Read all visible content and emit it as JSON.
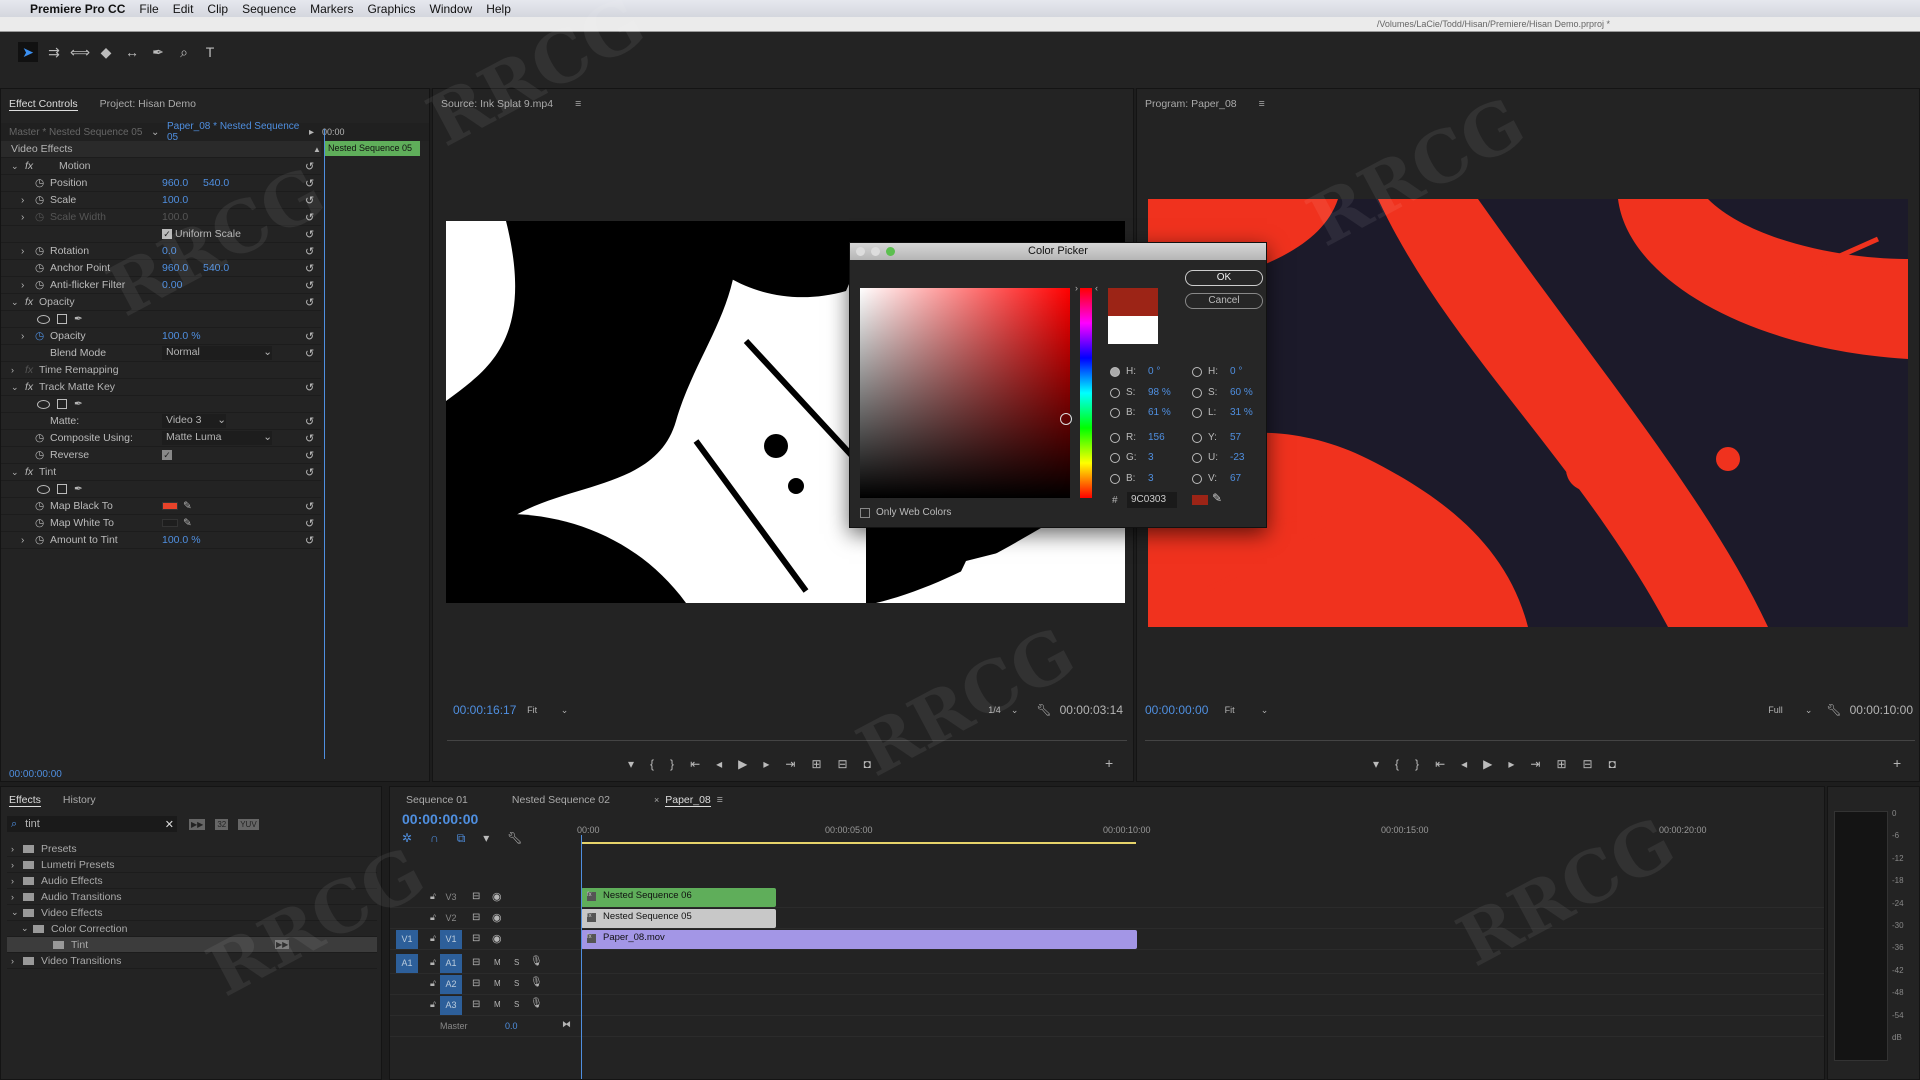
{
  "menu": {
    "app": "Premiere Pro CC",
    "items": [
      "File",
      "Edit",
      "Clip",
      "Sequence",
      "Markers",
      "Graphics",
      "Window",
      "Help"
    ]
  },
  "title_path": "/Volumes/LaCie/Todd/Hisan/Premiere/Hisan Demo.prproj *",
  "tools": [
    "selection-tool",
    "track-select-tool",
    "ripple-edit-tool",
    "razor-tool",
    "slip-tool",
    "pen-tool",
    "zoom-tool",
    "type-tool"
  ],
  "effect_controls": {
    "tabs": [
      "Effect Controls",
      "Project: Hisan Demo"
    ],
    "master": "Master * Nested Sequence 05",
    "clip": "Paper_08 * Nested Sequence 05",
    "ruler_time": "00:00",
    "clip_bar": "Nested Sequence 05",
    "section": "Video Effects",
    "rows": [
      {
        "t": "fx",
        "label": "Motion"
      },
      {
        "t": "p",
        "label": "Position",
        "v1": "960.0",
        "v2": "540.0"
      },
      {
        "t": "p",
        "label": "Scale",
        "v1": "100.0",
        "exp": true
      },
      {
        "t": "p",
        "label": "Scale Width",
        "v1": "100.0",
        "exp": true,
        "dim": true
      },
      {
        "t": "check",
        "label": "Uniform Scale"
      },
      {
        "t": "p",
        "label": "Rotation",
        "v1": "0.0",
        "exp": true
      },
      {
        "t": "p",
        "label": "Anchor Point",
        "v1": "960.0",
        "v2": "540.0"
      },
      {
        "t": "p",
        "label": "Anti-flicker Filter",
        "v1": "0.00",
        "exp": true
      },
      {
        "t": "fx",
        "label": "Opacity"
      },
      {
        "t": "mask"
      },
      {
        "t": "p",
        "label": "Opacity",
        "v1": "100.0 %",
        "exp": true
      },
      {
        "t": "sel",
        "label": "Blend Mode",
        "v1": "Normal"
      },
      {
        "t": "fx",
        "label": "Time Remapping",
        "collapsed": true
      },
      {
        "t": "fx",
        "label": "Track Matte Key"
      },
      {
        "t": "mask"
      },
      {
        "t": "sel",
        "label": "Matte:",
        "v1": "Video 3"
      },
      {
        "t": "sel",
        "label": "Composite Using:",
        "v1": "Matte Luma"
      },
      {
        "t": "check2",
        "label": "Reverse"
      },
      {
        "t": "fx",
        "label": "Tint"
      },
      {
        "t": "mask"
      },
      {
        "t": "color",
        "label": "Map Black To",
        "c": "#e8432a"
      },
      {
        "t": "color",
        "label": "Map White To",
        "c": "#1e1e1e"
      },
      {
        "t": "p",
        "label": "Amount to Tint",
        "v1": "100.0 %",
        "exp": true
      }
    ],
    "time": "00:00:00:00"
  },
  "source": {
    "title": "Source: Ink Splat 9.mp4",
    "timecode": "00:00:16:17",
    "fit": "Fit",
    "resolution": "1/4",
    "duration": "00:00:03:14"
  },
  "program": {
    "title": "Program: Paper_08",
    "timecode": "00:00:00:00",
    "fit": "Fit",
    "resolution": "Full",
    "duration": "00:00:10:00"
  },
  "color_picker": {
    "title": "Color Picker",
    "ok": "OK",
    "cancel": "Cancel",
    "only_web": "Only Web Colors",
    "hex": "9C0303",
    "new_color": "#9c2416",
    "old_color": "#ffffff",
    "left": [
      {
        "k": "H:",
        "v": "0 °",
        "on": true
      },
      {
        "k": "S:",
        "v": "98 %"
      },
      {
        "k": "B:",
        "v": "61 %"
      },
      {
        "k": "R:",
        "v": "156"
      },
      {
        "k": "G:",
        "v": "3"
      },
      {
        "k": "B:",
        "v": "3"
      }
    ],
    "right": [
      {
        "k": "H:",
        "v": "0 °"
      },
      {
        "k": "S:",
        "v": "60 %"
      },
      {
        "k": "L:",
        "v": "31 %"
      },
      {
        "k": "Y:",
        "v": "57"
      },
      {
        "k": "U:",
        "v": "-23"
      },
      {
        "k": "V:",
        "v": "67"
      }
    ]
  },
  "effects": {
    "tabs": [
      "Effects",
      "History"
    ],
    "search": "tint",
    "badges": [
      "32",
      "YUV"
    ],
    "tree": [
      {
        "l": "Presets",
        "d": 0
      },
      {
        "l": "Lumetri Presets",
        "d": 0
      },
      {
        "l": "Audio Effects",
        "d": 0
      },
      {
        "l": "Audio Transitions",
        "d": 0
      },
      {
        "l": "Video Effects",
        "d": 0,
        "open": true
      },
      {
        "l": "Color Correction",
        "d": 1,
        "open": true
      },
      {
        "l": "Tint",
        "d": 2,
        "sel": true
      },
      {
        "l": "Video Transitions",
        "d": 0
      }
    ]
  },
  "timeline": {
    "tabs": [
      "Sequence 01",
      "Nested Sequence 02",
      "Paper_08"
    ],
    "timecode": "00:00:00:00",
    "ruler": [
      "00:00",
      "00:00:05:00",
      "00:00:10:00",
      "00:00:15:00",
      "00:00:20:00"
    ],
    "tracks": [
      {
        "n": "V3"
      },
      {
        "n": "V2"
      },
      {
        "n": "V1",
        "src": "V1"
      },
      {
        "n": "A1",
        "src": "A1",
        "audio": true
      },
      {
        "n": "A2",
        "audio": true
      },
      {
        "n": "A3",
        "audio": true
      }
    ],
    "master": "Master",
    "master_val": "0.0",
    "clips": [
      {
        "name": "Nested Sequence 06",
        "track": 0,
        "start": 0,
        "end": 3.5,
        "color": "#5fae5a"
      },
      {
        "name": "Nested Sequence 05",
        "track": 1,
        "start": 0,
        "end": 3.5,
        "color": "#c8c8c8"
      },
      {
        "name": "Paper_08.mov",
        "track": 2,
        "start": 0,
        "end": 10,
        "color": "#a396e6"
      }
    ]
  },
  "meter": {
    "ticks": [
      "0",
      "-6",
      "-12",
      "-18",
      "-24",
      "-30",
      "-36",
      "-42",
      "-48",
      "-54",
      "dB"
    ],
    "solo": [
      "S",
      "S"
    ]
  },
  "colors": {
    "accent": "#4f8fe0",
    "tint_red": "#f0321e"
  }
}
